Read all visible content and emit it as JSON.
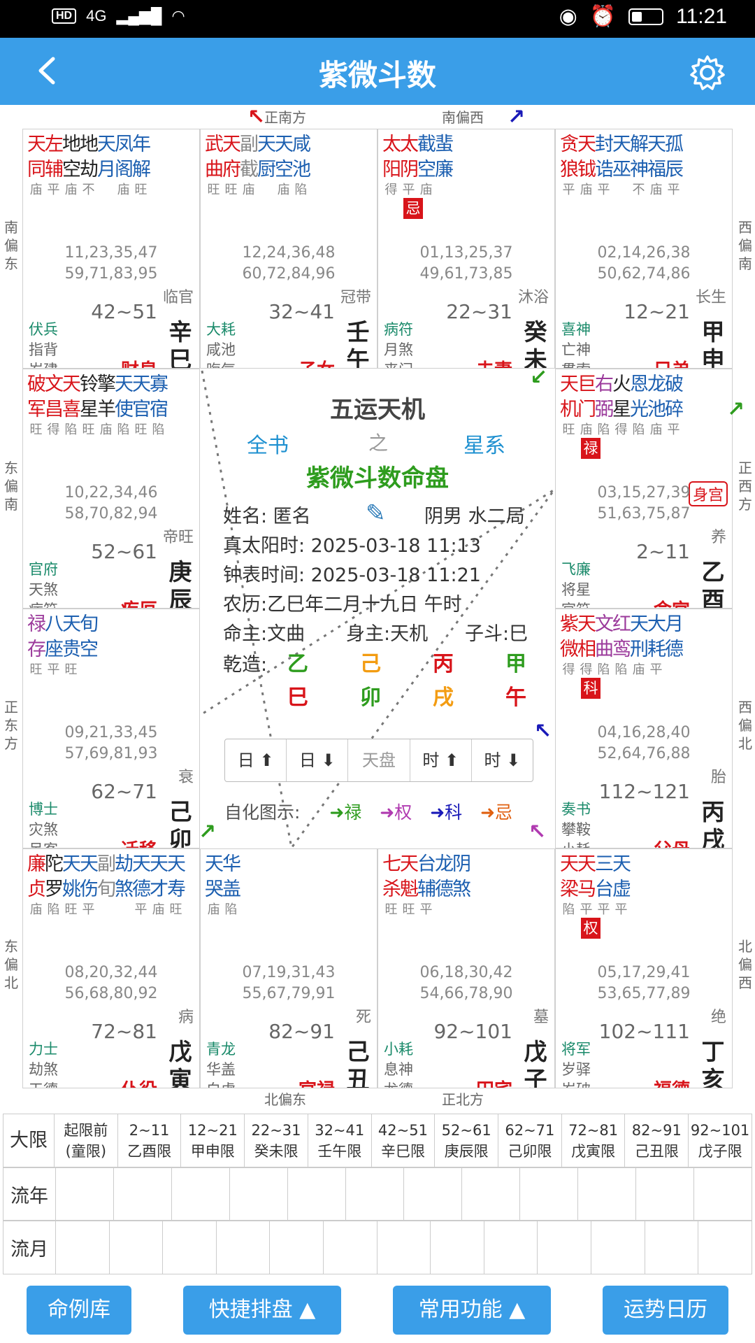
{
  "status": {
    "signal_left": "HD",
    "net": "4G",
    "time": "11:21"
  },
  "header": {
    "title": "紫微斗数"
  },
  "directions": {
    "top_left": "正南方",
    "top_right": "南偏西",
    "bottom_left": "北偏东",
    "bottom_right": "正北方",
    "left": [
      "南偏东",
      "东偏南",
      "正东方",
      "东偏北"
    ],
    "right": [
      "西偏南",
      "正西方",
      "西偏北",
      "北偏西"
    ]
  },
  "cells": [
    {
      "stars": [
        [
          "天",
          "左",
          "地",
          "地",
          "天",
          "凤",
          "年"
        ],
        [
          "同",
          "辅",
          "空",
          "劫",
          "月",
          "阁",
          "解"
        ]
      ],
      "colors": [
        "r",
        "r",
        "k",
        "k",
        "b",
        "b",
        "b"
      ],
      "bright": [
        "庙",
        "平",
        "庙",
        "不",
        "",
        "庙",
        "旺"
      ],
      "ages": [
        "11,23,35,47",
        "59,71,83,95"
      ],
      "stage": "临官",
      "range": "42~51",
      "gods": [
        "伏兵",
        "指背",
        "岁建"
      ],
      "palace": "财帛",
      "gz": [
        "辛",
        "巳"
      ]
    },
    {
      "stars": [
        [
          "武",
          "天",
          "副",
          "天",
          "天",
          "咸"
        ],
        [
          "曲",
          "府",
          "截",
          "厨",
          "空",
          "池"
        ]
      ],
      "colors": [
        "r",
        "r",
        "g",
        "b",
        "b",
        "b"
      ],
      "bright": [
        "旺",
        "旺",
        "庙",
        "",
        "庙",
        "陷"
      ],
      "ages": [
        "12,24,36,48",
        "60,72,84,96"
      ],
      "stage": "冠带",
      "range": "32~41",
      "gods": [
        "大耗",
        "咸池",
        "晦气"
      ],
      "palace": "子女",
      "gz": [
        "壬",
        "午"
      ]
    },
    {
      "stars": [
        [
          "太",
          "太",
          "截",
          "蜚"
        ],
        [
          "阳",
          "阴",
          "空",
          "廉"
        ]
      ],
      "colors": [
        "r",
        "r",
        "b",
        "b"
      ],
      "bright": [
        "得",
        "平",
        "庙",
        ""
      ],
      "badge": "忌",
      "ages": [
        "01,13,25,37",
        "49,61,73,85"
      ],
      "stage": "沐浴",
      "range": "22~31",
      "gods": [
        "病符",
        "月煞",
        "丧门"
      ],
      "palace": "夫妻",
      "gz": [
        "癸",
        "未"
      ]
    },
    {
      "stars": [
        [
          "贪",
          "天",
          "封",
          "天",
          "解",
          "天",
          "孤"
        ],
        [
          "狼",
          "钺",
          "诰",
          "巫",
          "神",
          "福",
          "辰"
        ]
      ],
      "colors": [
        "r",
        "r",
        "b",
        "b",
        "b",
        "b",
        "b"
      ],
      "bright": [
        "平",
        "庙",
        "平",
        "",
        "不",
        "庙",
        "平"
      ],
      "ages": [
        "02,14,26,38",
        "50,62,74,86"
      ],
      "stage": "长生",
      "range": "12~21",
      "gods": [
        "喜神",
        "亡神",
        "贯索"
      ],
      "palace": "兄弟",
      "gz": [
        "甲",
        "申"
      ]
    },
    {
      "stars": [
        [
          "破",
          "文",
          "天",
          "铃",
          "擎",
          "天",
          "天",
          "寡"
        ],
        [
          "军",
          "昌",
          "喜",
          "星",
          "羊",
          "使",
          "官",
          "宿"
        ]
      ],
      "colors": [
        "r",
        "r",
        "r",
        "k",
        "k",
        "b",
        "b",
        "b"
      ],
      "bright": [
        "旺",
        "得",
        "陷",
        "旺",
        "庙",
        "陷",
        "旺",
        "陷"
      ],
      "ages": [
        "10,22,34,46",
        "58,70,82,94"
      ],
      "stage": "帝旺",
      "range": "52~61",
      "gods": [
        "官府",
        "天煞",
        "病符"
      ],
      "palace": "疾厄",
      "gz": [
        "庚",
        "辰"
      ]
    },
    {
      "stars": [
        [
          "天",
          "巨",
          "右",
          "火",
          "恩",
          "龙",
          "破"
        ],
        [
          "机",
          "门",
          "弼",
          "星",
          "光",
          "池",
          "碎"
        ]
      ],
      "colors": [
        "r",
        "r",
        "p",
        "k",
        "b",
        "b",
        "b"
      ],
      "bright": [
        "旺",
        "庙",
        "陷",
        "得",
        "陷",
        "庙",
        "平"
      ],
      "badge": "禄",
      "tag": "身宫",
      "ages": [
        "03,15,27,39",
        "51,63,75,87"
      ],
      "stage": "养",
      "range": "2~11",
      "gods": [
        "飞廉",
        "将星",
        "官符"
      ],
      "palace": "命宫",
      "gz": [
        "乙",
        "酉"
      ]
    },
    {
      "stars": [
        [
          "禄",
          "八",
          "天",
          "旬"
        ],
        [
          "存",
          "座",
          "贵",
          "空"
        ]
      ],
      "colors": [
        "p",
        "b",
        "b",
        "b"
      ],
      "bright": [
        "旺",
        "平",
        "旺",
        ""
      ],
      "ages": [
        "09,21,33,45",
        "57,69,81,93"
      ],
      "stage": "衰",
      "range": "62~71",
      "gods": [
        "博士",
        "灾煞",
        "吊客"
      ],
      "palace": "迁移",
      "gz": [
        "己",
        "卯"
      ]
    },
    {
      "stars": [
        [
          "紫",
          "天",
          "文",
          "红",
          "天",
          "大",
          "月"
        ],
        [
          "微",
          "相",
          "曲",
          "鸾",
          "刑",
          "耗",
          "德"
        ]
      ],
      "colors": [
        "r",
        "r",
        "p",
        "p",
        "b",
        "b",
        "b"
      ],
      "bright": [
        "得",
        "得",
        "陷",
        "陷",
        "庙",
        "平",
        ""
      ],
      "badge": "科",
      "ages": [
        "04,16,28,40",
        "52,64,76,88"
      ],
      "stage": "胎",
      "range": "112~121",
      "gods": [
        "奏书",
        "攀鞍",
        "小耗"
      ],
      "palace": "父母",
      "gz": [
        "丙",
        "戌"
      ]
    },
    {
      "stars": [
        [
          "廉",
          "陀",
          "天",
          "天",
          "副",
          "劫",
          "天",
          "天",
          "天"
        ],
        [
          "贞",
          "罗",
          "姚",
          "伤",
          "旬",
          "煞",
          "德",
          "才",
          "寿"
        ]
      ],
      "colors": [
        "r",
        "k",
        "b",
        "b",
        "g",
        "b",
        "b",
        "b",
        "b"
      ],
      "bright": [
        "庙",
        "陷",
        "旺",
        "平",
        "",
        "",
        "平",
        "庙",
        "旺"
      ],
      "ages": [
        "08,20,32,44",
        "56,68,80,92"
      ],
      "stage": "病",
      "range": "72~81",
      "gods": [
        "力士",
        "劫煞",
        "天德"
      ],
      "palace": "仆役",
      "gz": [
        "戊",
        "寅"
      ]
    },
    {
      "stars": [
        [
          "天",
          "华"
        ],
        [
          "哭",
          "盖"
        ]
      ],
      "colors": [
        "b",
        "b"
      ],
      "bright": [
        "庙",
        "陷"
      ],
      "ages": [
        "07,19,31,43",
        "55,67,79,91"
      ],
      "stage": "死",
      "range": "82~91",
      "gods": [
        "青龙",
        "华盖",
        "白虎"
      ],
      "palace": "官禄",
      "gz": [
        "己",
        "丑"
      ]
    },
    {
      "stars": [
        [
          "七",
          "天",
          "台",
          "龙",
          "阴"
        ],
        [
          "杀",
          "魁",
          "辅",
          "德",
          "煞"
        ]
      ],
      "colors": [
        "r",
        "r",
        "b",
        "b",
        "b"
      ],
      "bright": [
        "旺",
        "旺",
        "平",
        "",
        ""
      ],
      "ages": [
        "06,18,30,42",
        "54,66,78,90"
      ],
      "stage": "墓",
      "range": "92~101",
      "gods": [
        "小耗",
        "息神",
        "龙德"
      ],
      "palace": "田宅",
      "gz": [
        "戊",
        "子"
      ]
    },
    {
      "stars": [
        [
          "天",
          "天",
          "三",
          "天"
        ],
        [
          "梁",
          "马",
          "台",
          "虚"
        ]
      ],
      "colors": [
        "r",
        "r",
        "b",
        "b"
      ],
      "bright": [
        "陷",
        "平",
        "平",
        "平"
      ],
      "badge": "权",
      "ages": [
        "05,17,29,41",
        "53,65,77,89"
      ],
      "stage": "绝",
      "range": "102~111",
      "gods": [
        "将军",
        "岁驿",
        "岁破"
      ],
      "palace": "福德",
      "gz": [
        "丁",
        "亥"
      ]
    }
  ],
  "center": {
    "title": "五运天机",
    "left": "全书",
    "mid": "之",
    "right": "星系",
    "main": "紫微斗数命盘",
    "name_line": "姓名: 匿名",
    "gender": "阴男 水二局",
    "solar": "真太阳时: 2025-03-18 11:13",
    "clock": "钟表时间: 2025-03-18 11:21",
    "lunar": "农历:乙巳年二月十九日  午时",
    "ming": "命主:文曲",
    "shen": "身主:天机",
    "zidou": "子斗:巳",
    "qianzao": "乾造:",
    "pillars_top": [
      "乙",
      "己",
      "丙",
      "甲"
    ],
    "pillars_bot": [
      "巳",
      "卯",
      "戌",
      "午"
    ],
    "buttons": [
      "日 ⬆",
      "日 ⬇",
      "天盘",
      "时 ⬆",
      "时 ⬇"
    ],
    "legend_label": "自化图示:",
    "legend": [
      "➜禄",
      "➜权",
      "➜科",
      "➜忌"
    ]
  },
  "daxian": {
    "header": "大限",
    "cols": [
      [
        "起限前",
        "(童限)"
      ],
      [
        "2~11",
        "乙酉限"
      ],
      [
        "12~21",
        "甲申限"
      ],
      [
        "22~31",
        "癸未限"
      ],
      [
        "32~41",
        "壬午限"
      ],
      [
        "42~51",
        "辛巳限"
      ],
      [
        "52~61",
        "庚辰限"
      ],
      [
        "62~71",
        "己卯限"
      ],
      [
        "72~81",
        "戊寅限"
      ],
      [
        "82~91",
        "己丑限"
      ],
      [
        "92~101",
        "戊子限"
      ]
    ]
  },
  "liunian": {
    "header": "流年"
  },
  "liuyue": {
    "header": "流月"
  },
  "bottom_buttons": [
    "命例库",
    "快捷排盘 ▲",
    "常用功能 ▲",
    "运势日历"
  ],
  "colors": {
    "accent": "#3a9ee8",
    "red": "#d8141a",
    "blue": "#1c5fb0",
    "purple": "#9b3a9b",
    "green": "#2e9c1e"
  }
}
